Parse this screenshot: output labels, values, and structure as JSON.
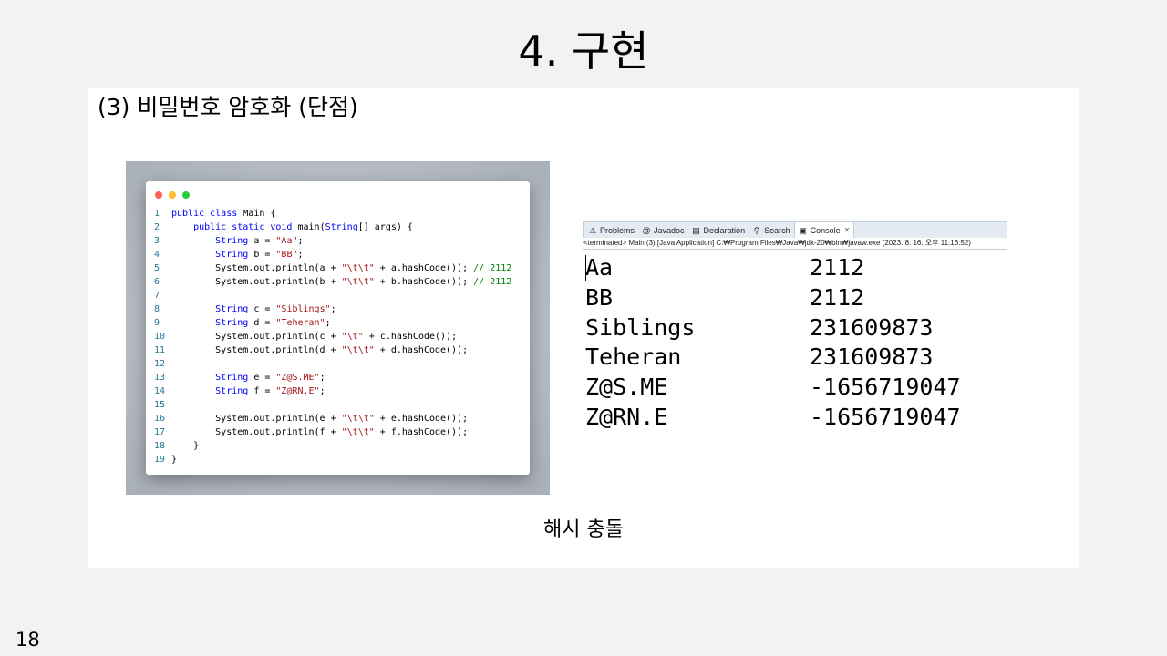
{
  "slide": {
    "title": "4. 구현",
    "section_heading": "(3) 비밀번호 암호화 (단점)",
    "caption": "해시 충돌",
    "page_number": "18"
  },
  "code": {
    "window_buttons": [
      "red",
      "yellow",
      "green"
    ],
    "lines": [
      {
        "n": "1",
        "tokens": [
          {
            "t": "public class ",
            "c": "kw"
          },
          {
            "t": "Main {",
            "c": "tx"
          }
        ]
      },
      {
        "n": "2",
        "tokens": [
          {
            "t": "    public static void ",
            "c": "kw"
          },
          {
            "t": "main(",
            "c": "tx"
          },
          {
            "t": "String",
            "c": "kw"
          },
          {
            "t": "[] args) {",
            "c": "tx"
          }
        ]
      },
      {
        "n": "3",
        "tokens": [
          {
            "t": "        String ",
            "c": "kw"
          },
          {
            "t": "a = ",
            "c": "tx"
          },
          {
            "t": "\"Aa\"",
            "c": "str"
          },
          {
            "t": ";",
            "c": "tx"
          }
        ]
      },
      {
        "n": "4",
        "tokens": [
          {
            "t": "        String ",
            "c": "kw"
          },
          {
            "t": "b = ",
            "c": "tx"
          },
          {
            "t": "\"BB\"",
            "c": "str"
          },
          {
            "t": ";",
            "c": "tx"
          }
        ]
      },
      {
        "n": "5",
        "tokens": [
          {
            "t": "        System.out.println(a + ",
            "c": "tx"
          },
          {
            "t": "\"\\t\\t\"",
            "c": "str"
          },
          {
            "t": " + a.hashCode()); ",
            "c": "tx"
          },
          {
            "t": "// 2112",
            "c": "cm"
          }
        ]
      },
      {
        "n": "6",
        "tokens": [
          {
            "t": "        System.out.println(b + ",
            "c": "tx"
          },
          {
            "t": "\"\\t\\t\"",
            "c": "str"
          },
          {
            "t": " + b.hashCode()); ",
            "c": "tx"
          },
          {
            "t": "// 2112",
            "c": "cm"
          }
        ]
      },
      {
        "n": "7",
        "tokens": []
      },
      {
        "n": "8",
        "tokens": [
          {
            "t": "        String ",
            "c": "kw"
          },
          {
            "t": "c = ",
            "c": "tx"
          },
          {
            "t": "\"Siblings\"",
            "c": "str"
          },
          {
            "t": ";",
            "c": "tx"
          }
        ]
      },
      {
        "n": "9",
        "tokens": [
          {
            "t": "        String ",
            "c": "kw"
          },
          {
            "t": "d = ",
            "c": "tx"
          },
          {
            "t": "\"Teheran\"",
            "c": "str"
          },
          {
            "t": ";",
            "c": "tx"
          }
        ]
      },
      {
        "n": "10",
        "tokens": [
          {
            "t": "        System.out.println(c + ",
            "c": "tx"
          },
          {
            "t": "\"\\t\"",
            "c": "str"
          },
          {
            "t": " + c.hashCode());",
            "c": "tx"
          }
        ]
      },
      {
        "n": "11",
        "tokens": [
          {
            "t": "        System.out.println(d + ",
            "c": "tx"
          },
          {
            "t": "\"\\t\\t\"",
            "c": "str"
          },
          {
            "t": " + d.hashCode());",
            "c": "tx"
          }
        ]
      },
      {
        "n": "12",
        "tokens": []
      },
      {
        "n": "13",
        "tokens": [
          {
            "t": "        String ",
            "c": "kw"
          },
          {
            "t": "e = ",
            "c": "tx"
          },
          {
            "t": "\"Z@S.ME\"",
            "c": "str"
          },
          {
            "t": ";",
            "c": "tx"
          }
        ]
      },
      {
        "n": "14",
        "tokens": [
          {
            "t": "        String ",
            "c": "kw"
          },
          {
            "t": "f = ",
            "c": "tx"
          },
          {
            "t": "\"Z@RN.E\"",
            "c": "str"
          },
          {
            "t": ";",
            "c": "tx"
          }
        ]
      },
      {
        "n": "15",
        "tokens": []
      },
      {
        "n": "16",
        "tokens": [
          {
            "t": "        System.out.println(e + ",
            "c": "tx"
          },
          {
            "t": "\"\\t\\t\"",
            "c": "str"
          },
          {
            "t": " + e.hashCode());",
            "c": "tx"
          }
        ]
      },
      {
        "n": "17",
        "tokens": [
          {
            "t": "        System.out.println(f + ",
            "c": "tx"
          },
          {
            "t": "\"\\t\\t\"",
            "c": "str"
          },
          {
            "t": " + f.hashCode());",
            "c": "tx"
          }
        ]
      },
      {
        "n": "18",
        "tokens": [
          {
            "t": "    }",
            "c": "tx"
          }
        ]
      },
      {
        "n": "19",
        "tokens": [
          {
            "t": "}",
            "c": "tx"
          }
        ]
      }
    ]
  },
  "console": {
    "tabs": [
      {
        "label": "Problems",
        "icon": "problems-icon",
        "glyph": "⚠"
      },
      {
        "label": "Javadoc",
        "icon": "javadoc-icon",
        "glyph": "@"
      },
      {
        "label": "Declaration",
        "icon": "declaration-icon",
        "glyph": "▤"
      },
      {
        "label": "Search",
        "icon": "search-icon",
        "glyph": "⚲"
      },
      {
        "label": "Console",
        "icon": "console-icon",
        "glyph": "▣",
        "active": true
      }
    ],
    "status": "<terminated> Main (3) [Java Application] C:₩Program Files₩Java₩jdk-20₩bin₩javaw.exe (2023. 8. 16. 오후 11:16:52)",
    "output": [
      {
        "label": "Aa",
        "value": "2112"
      },
      {
        "label": "BB",
        "value": "2112"
      },
      {
        "label": "Siblings",
        "value": "231609873"
      },
      {
        "label": "Teheran",
        "value": "231609873"
      },
      {
        "label": "Z@S.ME",
        "value": "-1656719047"
      },
      {
        "label": "Z@RN.E",
        "value": "-1656719047"
      }
    ]
  },
  "colors": {
    "keyword": "#0000ff",
    "string": "#a31515",
    "comment": "#008000",
    "line_number": "#237893"
  }
}
